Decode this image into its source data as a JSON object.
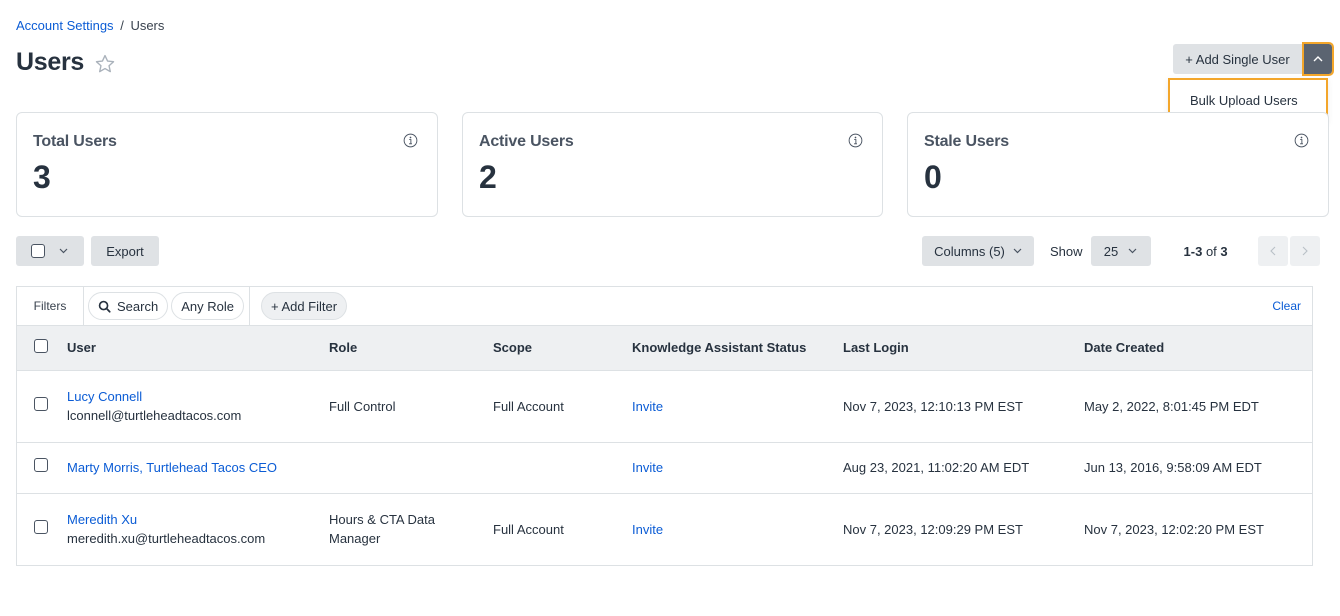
{
  "breadcrumb": {
    "parent": "Account Settings",
    "separator": "/",
    "current": "Users"
  },
  "page": {
    "title": "Users",
    "favorite_icon": "star-outline-icon"
  },
  "actions": {
    "add_single_user": "+ Add Single User",
    "menu_toggle_icon": "chevron-up-icon",
    "dropdown_items": [
      "Bulk Upload Users"
    ]
  },
  "stats": [
    {
      "label": "Total Users",
      "value": "3",
      "icon": "info-icon"
    },
    {
      "label": "Active Users",
      "value": "2",
      "icon": "info-icon"
    },
    {
      "label": "Stale Users",
      "value": "0",
      "icon": "info-icon"
    }
  ],
  "toolbar": {
    "export": "Export",
    "columns": "Columns (5)",
    "show_label": "Show",
    "page_size": "25",
    "range": "1-3",
    "of_text": "of",
    "total": "3"
  },
  "filters": {
    "label": "Filters",
    "search": "Search",
    "role": "Any Role",
    "add_filter": "+ Add Filter",
    "clear": "Clear"
  },
  "table": {
    "columns": [
      "User",
      "Role",
      "Scope",
      "Knowledge Assistant Status",
      "Last Login",
      "Date Created"
    ],
    "rows": [
      {
        "name": "Lucy Connell",
        "email": "lconnell@turtleheadtacos.com",
        "role": "Full Control",
        "scope": "Full Account",
        "ka_status": "Invite",
        "last_login": "Nov 7, 2023, 12:10:13 PM EST",
        "created": "May 2, 2022, 8:01:45 PM EDT"
      },
      {
        "name": "Marty Morris, Turtlehead Tacos CEO",
        "email": "",
        "role": "",
        "scope": "",
        "ka_status": "Invite",
        "last_login": "Aug 23, 2021, 11:02:20 AM EDT",
        "created": "Jun 13, 2016, 9:58:09 AM EDT"
      },
      {
        "name": "Meredith Xu",
        "email": "meredith.xu@turtleheadtacos.com",
        "role": "Hours & CTA Data Manager",
        "scope": "Full Account",
        "ka_status": "Invite",
        "last_login": "Nov 7, 2023, 12:09:29 PM EST",
        "created": "Nov 7, 2023, 12:02:20 PM EST"
      }
    ]
  },
  "colors": {
    "link": "#0b5cd5",
    "highlight": "#f3a62b",
    "button_grey": "#dfe2e5",
    "dark_button": "#5b6471"
  }
}
